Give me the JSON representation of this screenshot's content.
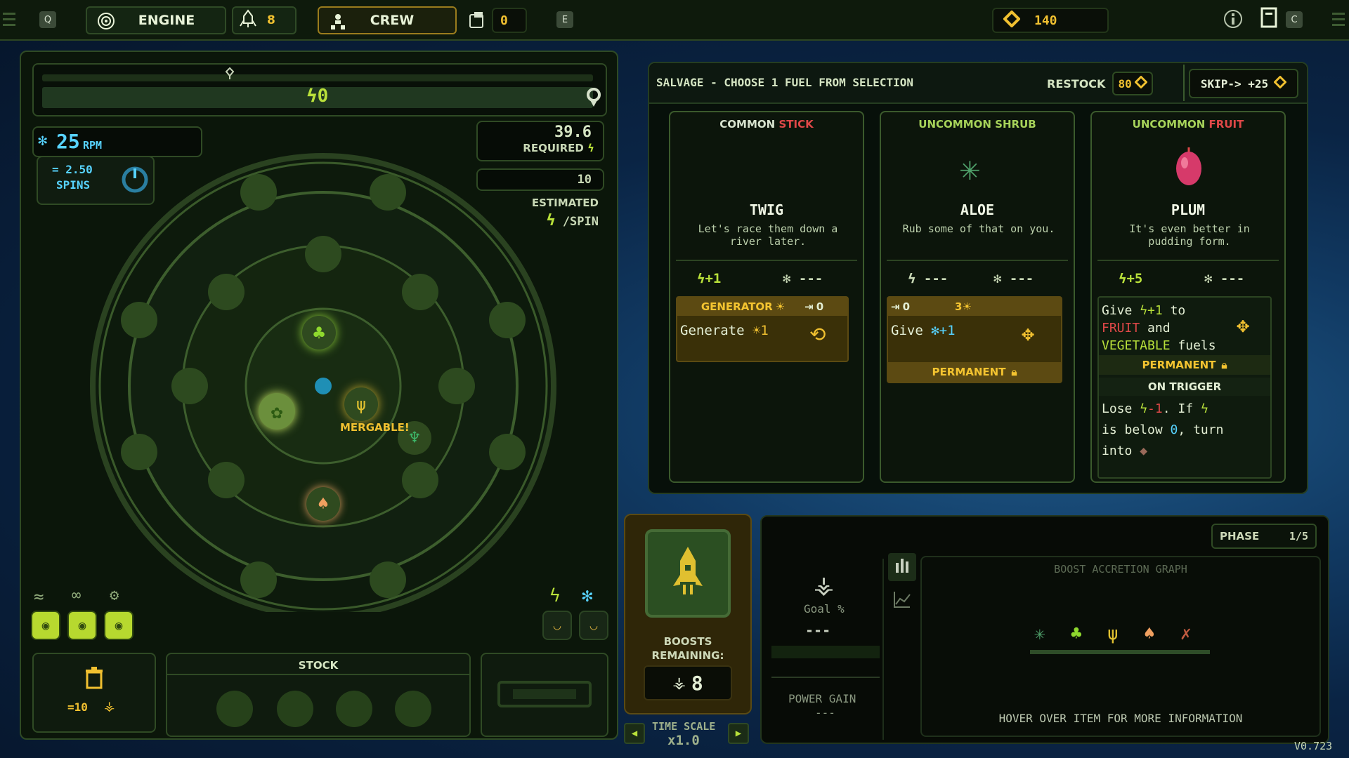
{
  "topbar": {
    "key_q": "Q",
    "engine_label": "ENGINE",
    "engine_icon": "target-icon",
    "boost_count": "8",
    "crew_label": "CREW",
    "crew_count": "0",
    "key_e": "E",
    "currency": "140",
    "key_c": "C"
  },
  "engine": {
    "power_value": "0",
    "rpm_value": "25",
    "rpm_unit": "RPM",
    "spins_value": "= 2.50",
    "spins_label": "SPINS",
    "required_value": "39.6",
    "required_label": "REQUIRED",
    "estimated_value": "10",
    "estimated_label": "ESTIMATED",
    "per_spin_label": "/SPIN",
    "mergable_label": "MERGABLE!",
    "trash_label": "=10",
    "stock_title": "STOCK"
  },
  "shop": {
    "title": "SALVAGE - CHOOSE 1 FUEL FROM SELECTION",
    "restock_label": "RESTOCK",
    "restock_cost": "80",
    "skip_label": "SKIP-> +25",
    "cards": [
      {
        "rarity": "COMMON",
        "type": "STICK",
        "name": "TWIG",
        "desc": "Let's race them down a river later.",
        "power": "+1",
        "spin": "---",
        "ability_header": "GENERATOR",
        "ability_header_count": "0",
        "ability_text": "Generate",
        "ability_value": "1"
      },
      {
        "rarity": "UNCOMMON",
        "type": "SHRUB",
        "name": "ALOE",
        "desc": "Rub some of that on you.",
        "power": "---",
        "spin": "---",
        "ability_header_left": "0",
        "ability_header_right": "3",
        "ability_text": "Give",
        "ability_value": "+1",
        "tag": "PERMANENT"
      },
      {
        "rarity": "UNCOMMON",
        "type": "FRUIT",
        "name": "PLUM",
        "desc": "It's even better in pudding form.",
        "power": "+5",
        "spin": "---",
        "ability_give": "Give",
        "ability_value": "+1",
        "ability_to": "to",
        "ability_fruit": "FRUIT",
        "ability_and": "and",
        "ability_veg": "VEGETABLE",
        "ability_fuels": "fuels",
        "tag": "PERMANENT",
        "trigger_header": "ON TRIGGER",
        "trigger_lose": "Lose",
        "trigger_lose_value": "-1",
        "trigger_if": ". If",
        "trigger_is_below": "is below",
        "trigger_zero": "0",
        "trigger_turn": ", turn",
        "trigger_into": "into"
      }
    ]
  },
  "boost": {
    "remaining_label": "BOOSTS\nREMAINING:",
    "remaining_value": "8",
    "time_scale_label": "TIME SCALE",
    "time_scale_value": "x1.0"
  },
  "accretion": {
    "phase_label": "PHASE",
    "phase_value": "1/5",
    "goal_label": "Goal %",
    "goal_value": "---",
    "power_gain_label": "POWER GAIN",
    "power_gain_value": "---",
    "graph_title": "BOOST ACCRETION GRAPH",
    "hover_hint": "HOVER OVER ITEM FOR MORE INFORMATION"
  },
  "version": "V0.723",
  "colors": {
    "accent": "#b8e03a",
    "gold": "#f0c030",
    "red": "#e04848",
    "cyan": "#57d3ff"
  }
}
